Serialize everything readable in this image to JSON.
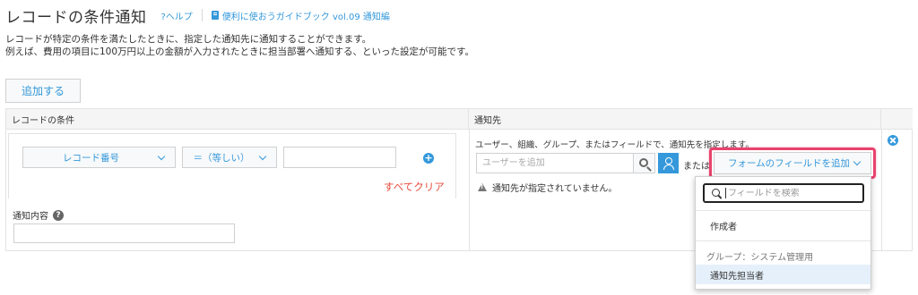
{
  "header": {
    "title": "レコードの条件通知",
    "help_link": "?ヘルプ",
    "guide_link": "便利に使おうガイドブック vol.09 通知編"
  },
  "description": {
    "line1": "レコードが特定の条件を満たしたときに、指定した通知先に通知することができます。",
    "line2": "例えば、費用の項目に100万円以上の金額が入力されたときに担当部署へ通知する、といった設定が可能です。"
  },
  "add_button": "追加する",
  "table": {
    "header_conditions": "レコードの条件",
    "header_recipients": "通知先"
  },
  "condition": {
    "field_select": "レコード番号",
    "operator_select": "＝（等しい）",
    "value": "",
    "clear_all": "すべてクリア",
    "notice_label": "通知内容",
    "notice_value": ""
  },
  "recipients": {
    "description": "ユーザー、組織、グループ、またはフィールドで、通知先を指定します。",
    "user_input_placeholder": "ユーザーを追加",
    "or_text": "または",
    "form_field_select": "フォームのフィールドを追加",
    "warning": "通知先が指定されていません。"
  },
  "dropdown": {
    "search_placeholder": "フィールドを検索",
    "items": [
      {
        "label": "作成者"
      },
      {
        "label": "グループ：システム管理用"
      },
      {
        "label": "通知先担当者"
      }
    ]
  },
  "colors": {
    "accent": "#3498db",
    "highlight": "#e8436d",
    "danger": "#e74c3c"
  }
}
